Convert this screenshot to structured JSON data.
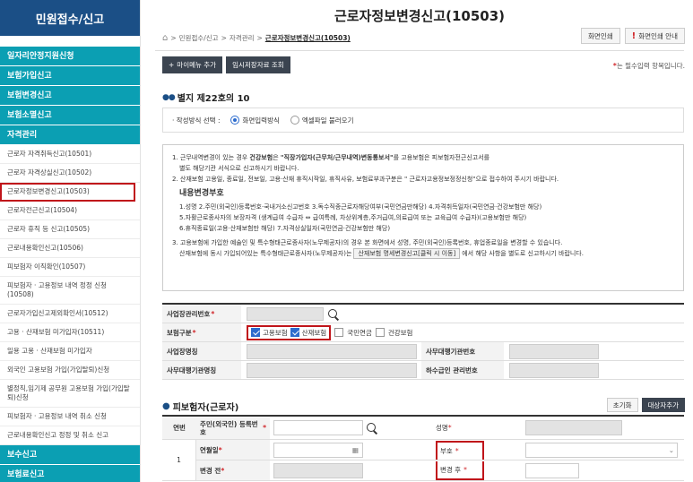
{
  "sidebar": {
    "title": "민원접수/신고",
    "items": [
      {
        "label": "일자리안정지원신청",
        "type": "top"
      },
      {
        "label": "보험가입신고",
        "type": "top"
      },
      {
        "label": "보험변경신고",
        "type": "top"
      },
      {
        "label": "보험소멸신고",
        "type": "top"
      },
      {
        "label": "자격관리",
        "type": "top"
      },
      {
        "label": "근로자 자격취득신고(10501)",
        "type": "sub"
      },
      {
        "label": "근로자 자격상실신고(10502)",
        "type": "sub"
      },
      {
        "label": "근로자정보변경신고(10503)",
        "type": "sub",
        "active": true
      },
      {
        "label": "근로자전근신고(10504)",
        "type": "sub"
      },
      {
        "label": "근로자 휴직 등 신고(10505)",
        "type": "sub"
      },
      {
        "label": "근로내용확인신고(10506)",
        "type": "sub"
      },
      {
        "label": "피보험자 이직확인(10507)",
        "type": "sub"
      },
      {
        "label": "피보험자 · 고용정보 내역 정정 신청(10508)",
        "type": "sub"
      },
      {
        "label": "근로자가입신고제외확인서(10512)",
        "type": "sub"
      },
      {
        "label": "고용 · 산재보험 미가입자(10511)",
        "type": "sub"
      },
      {
        "label": "일용 고용 · 산재보험 미가입자",
        "type": "sub"
      },
      {
        "label": "외국인 고용보험 가입(가입탈퇴)신청",
        "type": "sub"
      },
      {
        "label": "별정직,임기제 공무원 고용보험 가입(가입탈퇴)신청",
        "type": "sub"
      },
      {
        "label": "피보험자 · 고용정보 내역 취소 신청",
        "type": "sub"
      },
      {
        "label": "근로내용확인신고 정정 및 취소 신고",
        "type": "sub"
      },
      {
        "label": "보수신고",
        "type": "top"
      },
      {
        "label": "보험료신고",
        "type": "top"
      }
    ]
  },
  "header": {
    "title": "근로자정보변경신고(10503)",
    "breadcrumb": [
      "민원접수/신고",
      "자격관리",
      "근로자정보변경신고(10503)"
    ],
    "print_label": "화면인쇄",
    "guide_label": "화면인쇄 안내",
    "guide_icon": "!"
  },
  "actions": {
    "add_menu_label": "마이메뉴 추가",
    "temp_label": "임시저장자료 조회",
    "required_star": "*",
    "required_note": "는 필수입력 항목입니다."
  },
  "form_section": {
    "title": "별지 제22호의 10",
    "method_label": "작성방식 선택 :",
    "option_screen": "화면입력방식",
    "option_excel": "엑셀파일 불러오기",
    "selected": "화면입력방식"
  },
  "notes": {
    "line1a": "1. 근무내역변경이 있는 경우 ",
    "line1b": "건강보험",
    "line1c": "은 ",
    "line1d": "\"직장가입자(근무처/근무내역)변동통보서\"",
    "line1e": "를 고용보험은 피보험자전근신고서를",
    "line1f": "별도 해당기관 서식으로 신고하시기 바랍니다.",
    "line2": "2. 산재보험 고용일, 종료일, 전보일, 고용·산재 휴직시작일, 휴직사유, 보험료부과구분은 \" 근로자고용정보정정신청\"으로 접수하여 주시기 바랍니다.",
    "items_title": "내용변경부호",
    "items1": "1.성명 2.주민(외국인)등록번호·국내거소신고번호 3.독수직종근로자해당여부(국민연금만해당) 4.자격취득일자(국민연금·건강보험만 해당)",
    "items2": "5.자활근로종사자의 보장자격 (생계급여 수급자 ⇔ 급여특례, 차상위계층,주거급여,의료급여 또는 교육급여 수급자)(고용보험만 해당)",
    "items3": "6.휴직종료일(고용·산재보험만 해당) 7.자격상실일자(국민연금·건강보험만 해당)",
    "line3a": "3. 고용보험에 가입한 예술인 및 특수형태근로종사자(노무제공자)의 경우 본 화면에서 성명, 주민(외국인)등록번호, 휴업종료일을 변경할 수 있습니다.",
    "line3b": "산재보험에 동시 가입되어있는 특수형태근로종사자(노무제공자)는",
    "line3btn": "산재보험 명세변경신고[클릭 시 이동]",
    "line3c": "에서 해당 사항을 별도로 신고하시기 바랍니다."
  },
  "business": {
    "mgmt_no_label": "사업장관리번호",
    "insurance_label": "보험구분",
    "ins_employment": "고용보험",
    "ins_industrial": "산재보험",
    "ins_pension": "국민연금",
    "ins_health": "건강보험",
    "name_label": "사업장명칭",
    "agency_no_label": "사무대행기관번호",
    "agency_name_label": "사무대행기관명칭",
    "sub_mgmt_label": "하수급인 관리번호"
  },
  "insured": {
    "title": "피보험자(근로자)",
    "reset_label": "초기화",
    "add_label": "대상자추가",
    "col_no": "연번",
    "row_no": "1",
    "rrn_label": "주민(외국인) 등록번호",
    "name_label": "성명",
    "birth_label": "연월일",
    "code_label": "부호",
    "before_label": "변경 전",
    "after_label": "변경 후"
  },
  "colors": {
    "sidebar_title": "#1b4f86",
    "sidebar_top": "#0b9fb3",
    "accent_red": "#c0141a",
    "check_blue": "#2c6bcd"
  }
}
